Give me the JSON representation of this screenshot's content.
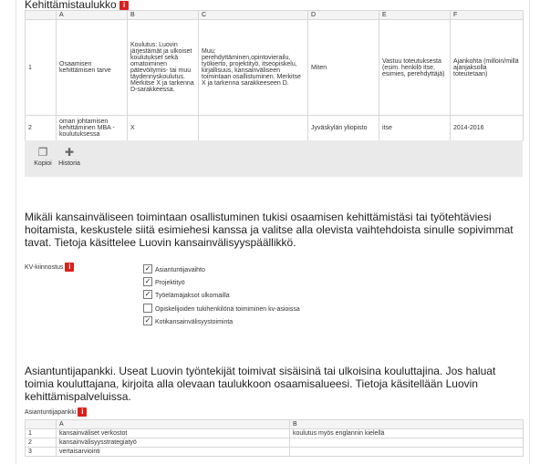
{
  "section1": {
    "title": "Kehittämistaulukko",
    "info_glyph": "i",
    "columns": [
      "A",
      "B",
      "C",
      "D",
      "E",
      "F"
    ],
    "rows": [
      {
        "num": "1",
        "cells": [
          "Osaamisen kehittämisen tarve",
          "Koulutus: Luovin järjestämät ja ulkoiset koulutukset sekä omatoiminen pätevöitymis- tai muu täydennyskoulutus. Merkitse X ja tarkenna D-sarakkeessa.",
          "Muu: perehdyttäminen,opintovierailu, työkierto, projektityö, itseopiskelu, kirjallisuus, kansainväliseen toimintaan osallistuminen. Merkitse X ja tarkenna sarakkeeseen D.",
          "Miten",
          "Vastuu toteutuksesta (esim. henkilö itse, esimies, perehdyttäjä)",
          "Ajankohta (milloin/millä ajanjaksolla toteutetaan)"
        ]
      },
      {
        "num": "2",
        "cells": [
          " oman johtamisen kehittäminen MBA -koulutuksessa",
          "X",
          "",
          "Jyväskylän yliopisto",
          "itse",
          "2014-2016"
        ]
      }
    ]
  },
  "toolbar": {
    "copy_label": "Kopioi",
    "history_label": "Historia"
  },
  "kv": {
    "intro": "Mikäli kansainväliseen toimintaan osallistuminen tukisi osaamisen kehittämistäsi tai työtehtäviesi hoitamista, keskustele siitä esimiehesi kanssa ja valitse alla olevista vaihtehdoista sinulle sopivimmat tavat. Tietoja käsittelee Luovin kansainvälisyyspäällikkö.",
    "label": "KV-kiinnostus",
    "options": [
      {
        "label": "Asiantuntijavaihto",
        "checked": true
      },
      {
        "label": "Projektityö",
        "checked": true
      },
      {
        "label": "Työelämäjaksot ulkomailla",
        "checked": true
      },
      {
        "label": "Opiskelijoiden tukihenkilönä toimiminen kv-asioissa",
        "checked": false
      },
      {
        "label": "Kotikansainvälisyystoiminta",
        "checked": true
      }
    ]
  },
  "asiantuntijapankki": {
    "intro": "Asiantuntijapankki. Useat Luovin työntekijät toimivat sisäisinä tai ulkoisina kouluttajina. Jos haluat toimia kouluttajana, kirjoita alla olevaan taulukkoon osaamisalueesi. Tietoja käsitellään Luovin kehittämispalveluissa.",
    "label": "Asiantuntijapankki",
    "columns": [
      "A",
      "B"
    ],
    "rows": [
      {
        "num": "1",
        "a": "kansainväliset verkostot",
        "b": "koulutus myös englannin kielellä"
      },
      {
        "num": "2",
        "a": "kansainvälisyysstrategiatyö",
        "b": ""
      },
      {
        "num": "3",
        "a": "vertaisarviointi",
        "b": ""
      }
    ]
  },
  "colors": {
    "info_icon": "#d9211b",
    "toolbar_bg": "#eaeaea",
    "header_bg": "#f4f4f4",
    "grid_border": "#d7d7d7"
  }
}
